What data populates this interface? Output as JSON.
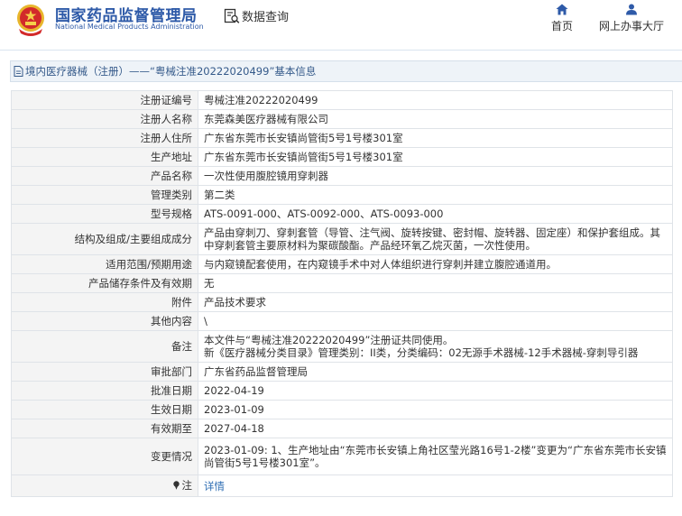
{
  "header": {
    "brand_cn": "国家药品监督管理局",
    "brand_en": "National Medical Products Administration",
    "search_label": "数据查询",
    "nav_home_label": "首页",
    "nav_office_label": "网上办事大厅"
  },
  "breadcrumb": {
    "title": "境内医疗器械（注册）——“粤械注准20222020499”基本信息"
  },
  "fields": {
    "reg_no": {
      "key": "注册证编号",
      "value": "粤械注准20222020499"
    },
    "registrant": {
      "key": "注册人名称",
      "value": "东莞森美医疗器械有限公司"
    },
    "registrant_addr": {
      "key": "注册人住所",
      "value": "广东省东莞市长安镇尚管街5号1号楼301室"
    },
    "prod_addr": {
      "key": "生产地址",
      "value": "广东省东莞市长安镇尚管街5号1号楼301室"
    },
    "product_name": {
      "key": "产品名称",
      "value": "一次性使用腹腔镜用穿刺器"
    },
    "category": {
      "key": "管理类别",
      "value": "第二类"
    },
    "model": {
      "key": "型号规格",
      "value": "ATS-0091-000、ATS-0092-000、ATS-0093-000"
    },
    "structure": {
      "key": "结构及组成/主要组成成分",
      "value": "产品由穿刺刀、穿刺套管（导管、注气阀、旋转按键、密封帽、旋转器、固定座）和保护套组成。其中穿刺套管主要原材料为聚碳酸酯。产品经环氧乙烷灭菌，一次性使用。"
    },
    "scope": {
      "key": "适用范围/预期用途",
      "value": "与内窥镜配套使用，在内窥镜手术中对人体组织进行穿刺并建立腹腔通道用。"
    },
    "storage": {
      "key": "产品储存条件及有效期",
      "value": "无"
    },
    "attachment": {
      "key": "附件",
      "value": "产品技术要求"
    },
    "other": {
      "key": "其他内容",
      "value": "\\"
    },
    "remark": {
      "key": "备注",
      "line1": "本文件与“粤械注准20222020499”注册证共同使用。",
      "line2": "新《医疗器械分类目录》管理类别：II类，分类编码：02无源手术器械-12手术器械-穿刺导引器"
    },
    "approval_dept": {
      "key": "审批部门",
      "value": "广东省药品监督管理局"
    },
    "approval_date": {
      "key": "批准日期",
      "value": "2022-04-19"
    },
    "effective_date": {
      "key": "生效日期",
      "value": "2023-01-09"
    },
    "expiry_date": {
      "key": "有效期至",
      "value": "2027-04-18"
    },
    "change": {
      "key": "变更情况",
      "value": "2023-01-09: 1、生产地址由“东莞市长安镇上角社区莹光路16号1-2楼”变更为“广东省东莞市长安镇尚管街5号1号楼301室”。"
    },
    "note": {
      "key": "注",
      "value": "详情"
    }
  },
  "colors": {
    "brand_blue": "#2e5aa8",
    "emblem_red": "#d22a2a",
    "emblem_gold": "#e8b62c",
    "link_blue": "#2e6db3",
    "key_bg": "#f4f4f4",
    "title_bg": "#eef3f8"
  },
  "icons": {
    "emblem": "national-emblem-icon",
    "search": "data-search-icon",
    "home": "home-icon",
    "office": "user-icon",
    "doc": "document-icon",
    "note": "pin-icon"
  }
}
